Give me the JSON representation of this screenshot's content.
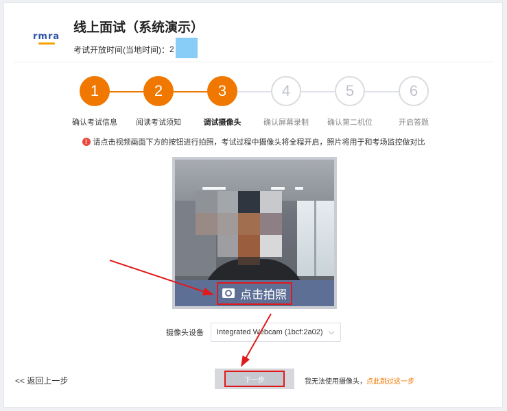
{
  "header": {
    "logo_text": "rmra",
    "title": "线上面试（系统演示）",
    "time_label": "考试开放时间(当地时间)：",
    "time_value_partial": "2"
  },
  "steps": [
    {
      "number": "1",
      "label": "确认考试信息",
      "state": "done"
    },
    {
      "number": "2",
      "label": "阅读考试须知",
      "state": "done"
    },
    {
      "number": "3",
      "label": "调试摄像头",
      "state": "active"
    },
    {
      "number": "4",
      "label": "确认屏幕录制",
      "state": "todo"
    },
    {
      "number": "5",
      "label": "确认第二机位",
      "state": "todo"
    },
    {
      "number": "6",
      "label": "开启答题",
      "state": "todo"
    }
  ],
  "notice": {
    "icon": "warning-icon",
    "text": "请点击视频画面下方的按钮进行拍照，考试过程中摄像头将全程开启，照片将用于和考场监控做对比"
  },
  "camera": {
    "capture_label": "点击拍照",
    "capture_icon": "camera-icon"
  },
  "device": {
    "label": "摄像头设备",
    "selected": "Integrated Webcam (1bcf:2a02)"
  },
  "footer": {
    "back_label": "<< 返回上一步",
    "next_label": "下一步",
    "skip_prefix": "我无法使用摄像头，",
    "skip_link": "点此跳过这一步"
  },
  "colors": {
    "accent": "#f07800",
    "capture_bar": "#5e6f96",
    "annotation_red": "#e0191a",
    "warning": "#e84a3b"
  }
}
